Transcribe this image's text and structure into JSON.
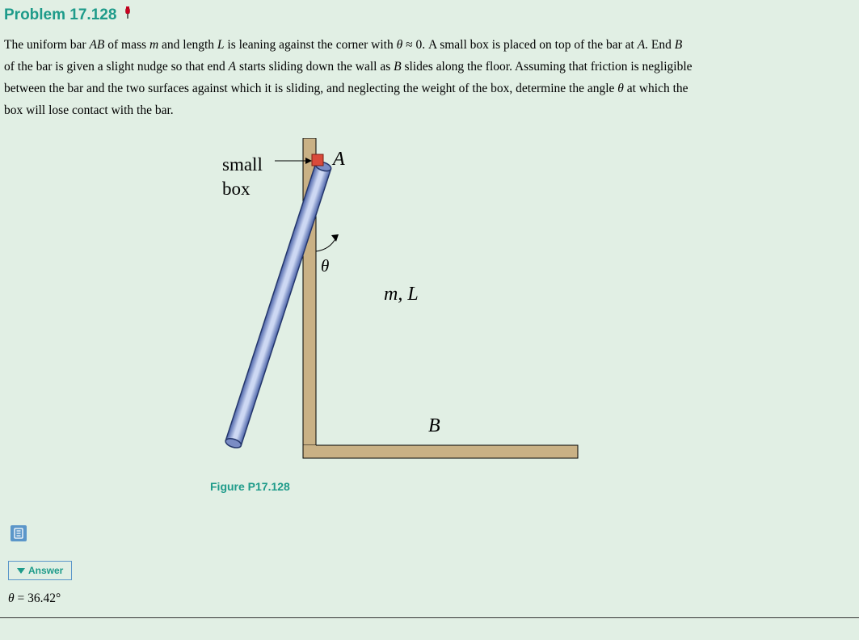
{
  "problem": {
    "number": "Problem 17.128",
    "text_parts": {
      "p1a": "The uniform bar ",
      "p1b": "AB",
      "p1c": " of mass ",
      "p1d": "m",
      "p1e": " and length ",
      "p1f": "L",
      "p1g": " is leaning against the corner with ",
      "p1h": "θ",
      "p1i": " ≈ 0. A small box is placed on top of the bar at ",
      "p1j": "A",
      "p1k": ". End ",
      "p1l": "B",
      "p2a": "of the bar is given a slight nudge so that end ",
      "p2b": "A",
      "p2c": " starts sliding down the wall as ",
      "p2d": "B",
      "p2e": " slides along the floor. Assuming that friction is negligible",
      "p3a": "between the bar and the two surfaces against which it is sliding, and neglecting the weight of the box, determine the angle ",
      "p3b": "θ",
      "p3c": " at which the",
      "p4a": "box will lose contact with the bar."
    }
  },
  "figure": {
    "label_smallbox_1": "small",
    "label_smallbox_2": "box",
    "label_A": "A",
    "label_B": "B",
    "label_theta": "θ",
    "label_mL": "m, L",
    "caption": "Figure P17.128"
  },
  "answer": {
    "toggle_label": "Answer",
    "text_prefix": "θ",
    "text_value": " = 36.42°"
  }
}
